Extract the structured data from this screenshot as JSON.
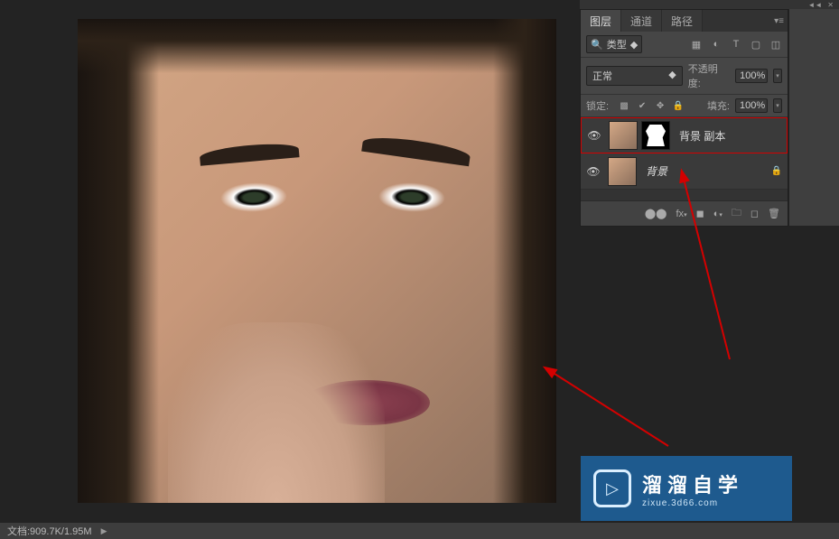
{
  "panel": {
    "tabs": {
      "layers": "图层",
      "channels": "通道",
      "paths": "路径"
    },
    "filter": {
      "label": "类型"
    },
    "blend": {
      "mode": "正常",
      "opacity_label": "不透明度:",
      "opacity_value": "100%"
    },
    "lock": {
      "label": "锁定:",
      "fill_label": "填充:",
      "fill_value": "100%"
    },
    "layers_list": [
      {
        "name": "背景 副本",
        "has_mask": true,
        "highlighted": true,
        "locked": false
      },
      {
        "name": "背景",
        "has_mask": false,
        "highlighted": false,
        "locked": true,
        "italic": true
      }
    ]
  },
  "statusbar": {
    "doc_info": "文档:909.7K/1.95M"
  },
  "watermark": {
    "cn": "溜溜自学",
    "en": "zixue.3d66.com"
  },
  "colors": {
    "annotation": "#d40000",
    "panel_bg": "#464646",
    "watermark_bg": "#1e5a8e"
  }
}
